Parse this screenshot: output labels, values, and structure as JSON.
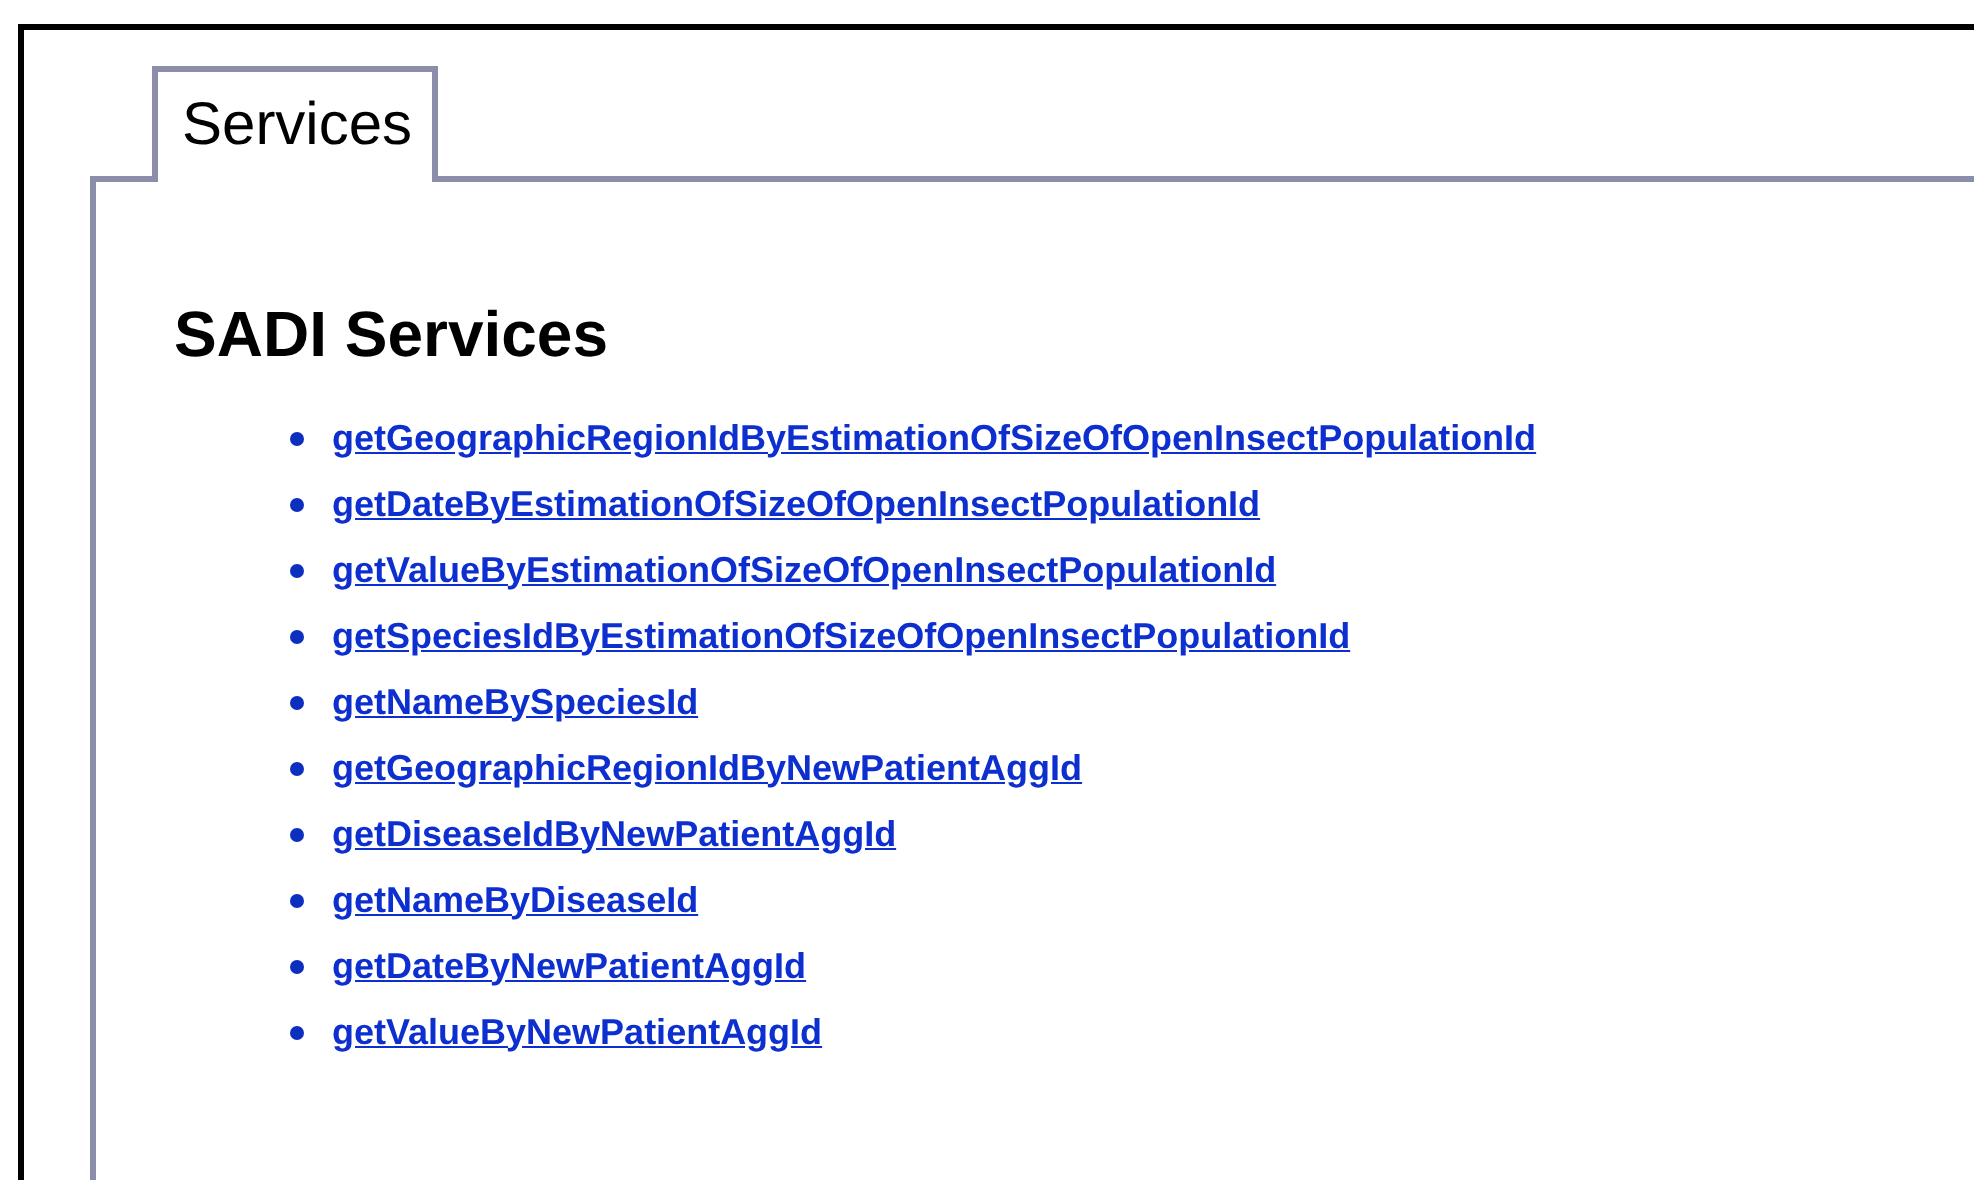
{
  "tabs": [
    {
      "label": "Services",
      "selected": true
    }
  ],
  "heading": "SADI Services",
  "services": [
    "getGeographicRegionIdByEstimationOfSizeOfOpenInsectPopulationId",
    "getDateByEstimationOfSizeOfOpenInsectPopulationId",
    "getValueByEstimationOfSizeOfOpenInsectPopulationId",
    "getSpeciesIdByEstimationOfSizeOfOpenInsectPopulationId",
    "getNameBySpeciesId",
    "getGeographicRegionIdByNewPatientAggId",
    "getDiseaseIdByNewPatientAggId",
    "getNameByDiseaseId",
    "getDateByNewPatientAggId",
    "getValueByNewPatientAggId"
  ]
}
